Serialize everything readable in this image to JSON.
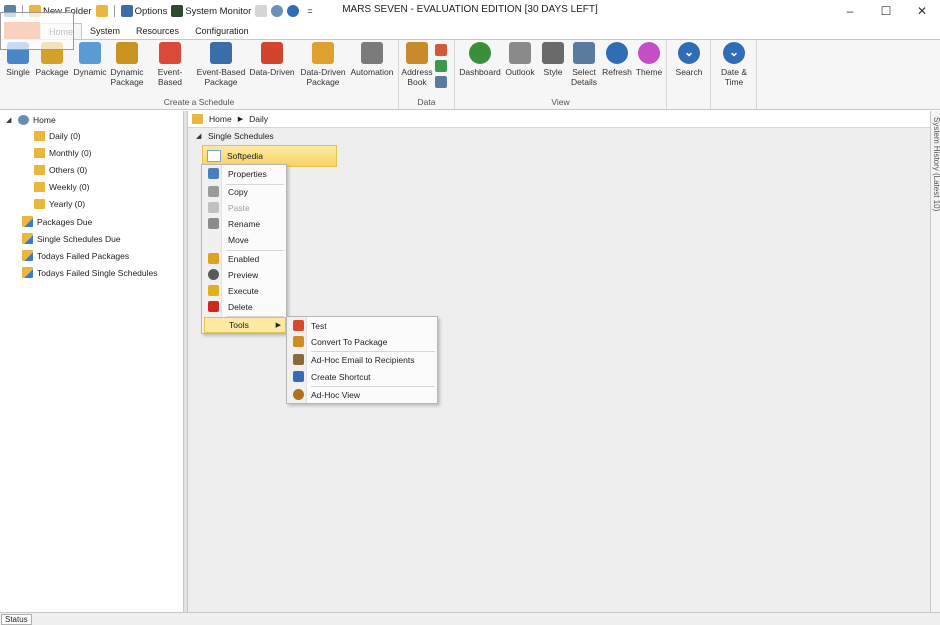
{
  "title_bar": {
    "window_title": "MARS SEVEN - EVALUATION EDITION [30 DAYS LEFT]",
    "qat": {
      "new_folder": "New Folder",
      "options": "Options",
      "system_monitor": "System Monitor"
    },
    "controls": {
      "minimize": "–",
      "maximize": "☐",
      "close": "✕"
    }
  },
  "ribbon": {
    "file_tab": "",
    "tabs": [
      "Home",
      "System",
      "Resources",
      "Configuration"
    ],
    "active_tab": "Home",
    "groups": {
      "create": {
        "label": "Create a Schedule",
        "buttons": [
          {
            "label": "Single",
            "color": "#4a86c5"
          },
          {
            "label": "Package",
            "color": "#d4a22a"
          },
          {
            "label": "Dynamic",
            "color": "#5b9bd5"
          },
          {
            "label": "Dynamic Package",
            "color": "#c8941f"
          },
          {
            "label": "Event-Based",
            "color": "#d94a3a"
          },
          {
            "label": "Event-Based Package",
            "color": "#3a6ea8"
          },
          {
            "label": "Data-Driven",
            "color": "#d2452c"
          },
          {
            "label": "Data-Driven Package",
            "color": "#e0a030"
          },
          {
            "label": "Automation",
            "color": "#7a7a7a"
          }
        ]
      },
      "data": {
        "label": "Data",
        "buttons": [
          {
            "label": "Address Book",
            "color": "#c98a2c"
          }
        ]
      },
      "view": {
        "label": "View",
        "buttons": [
          {
            "label": "Dashboard",
            "color": "#3a8f3a"
          },
          {
            "label": "Outlook",
            "color": "#8a8a8a"
          },
          {
            "label": "Style",
            "color": "#6a6a6a"
          },
          {
            "label": "Select Details",
            "color": "#5a7aa0"
          },
          {
            "label": "Refresh",
            "color": "#2f6db5"
          },
          {
            "label": "Theme",
            "color": "#c44fc4"
          }
        ]
      },
      "search": {
        "label": "Search"
      },
      "date": {
        "label": "Date & Time"
      }
    }
  },
  "tree": {
    "root": "Home",
    "folders": [
      "Daily (0)",
      "Monthly (0)",
      "Others (0)",
      "Weekly (0)",
      "Yearly (0)"
    ],
    "smart_folders": [
      "Packages Due",
      "Single Schedules Due",
      "Todays Failed Packages",
      "Todays Failed Single Schedules"
    ]
  },
  "breadcrumb": {
    "home": "Home",
    "current": "Daily"
  },
  "main": {
    "group_header": "Single Schedules",
    "selected_item": "Softpedia"
  },
  "context_menu": {
    "items": [
      {
        "label": "Properties",
        "color": "#4a7fbf"
      },
      {
        "label": "Copy",
        "color": "#9a9a9a"
      },
      {
        "label": "Paste",
        "color": "#c0c0c0"
      },
      {
        "label": "Rename",
        "color": "#8a8a8a"
      },
      {
        "label": "Move",
        "color": ""
      },
      {
        "label": "Enabled",
        "color": "#e0a020"
      },
      {
        "label": "Preview",
        "color": "#5a5a5a"
      },
      {
        "label": "Execute",
        "color": "#e0b020"
      },
      {
        "label": "Delete",
        "color": "#d0281e"
      },
      {
        "label": "Tools",
        "color": ""
      }
    ]
  },
  "submenu": {
    "items": [
      {
        "label": "Test",
        "color": "#d64a2a"
      },
      {
        "label": "Convert To Package",
        "color": "#d08a20"
      },
      {
        "label": "Ad-Hoc Email to Recipients",
        "color": "#8a6a3a"
      },
      {
        "label": "Create Shortcut",
        "color": "#3a6ab5"
      },
      {
        "label": "Ad-Hoc View",
        "color": "#b07020"
      }
    ]
  },
  "side_panel": {
    "text": "System History (Latest 10)"
  },
  "status": {
    "label": "Status"
  }
}
